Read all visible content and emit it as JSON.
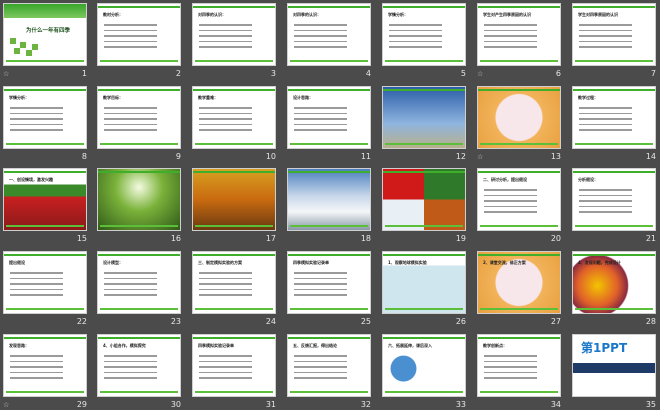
{
  "view": "slide-sorter",
  "accent_color": "#3fae2a",
  "animation_marker_icon": "star-icon",
  "animation_marker_glyph": "☆",
  "slides": [
    {
      "number": "1",
      "title": "为什么一年有四季",
      "kind": "title",
      "animated": true
    },
    {
      "number": "2",
      "title": "教材分析：",
      "kind": "diagram",
      "animated": false
    },
    {
      "number": "3",
      "title": "对四季的认识：",
      "kind": "diagram",
      "animated": false
    },
    {
      "number": "4",
      "title": "对四季的认识：",
      "kind": "diagram",
      "animated": false
    },
    {
      "number": "5",
      "title": "学情分析：",
      "kind": "table",
      "animated": false
    },
    {
      "number": "6",
      "title": "学生对产生四季原因的认识",
      "kind": "text",
      "animated": true
    },
    {
      "number": "7",
      "title": "学生对四季原因的认识",
      "kind": "text",
      "animated": false
    },
    {
      "number": "8",
      "title": "学情分析：",
      "kind": "text",
      "animated": false
    },
    {
      "number": "9",
      "title": "教学目标：",
      "kind": "text",
      "animated": false
    },
    {
      "number": "10",
      "title": "教学重难：",
      "kind": "text",
      "animated": false
    },
    {
      "number": "11",
      "title": "设计思路：",
      "kind": "diagram",
      "animated": false
    },
    {
      "number": "12",
      "title": "",
      "kind": "photo-sky",
      "animated": false
    },
    {
      "number": "13",
      "title": "",
      "kind": "photo-orange",
      "animated": true
    },
    {
      "number": "14",
      "title": "教学过程：",
      "kind": "text",
      "animated": false
    },
    {
      "number": "15",
      "title": "一、创设情境，激发兴趣",
      "kind": "photo-flowers",
      "animated": false
    },
    {
      "number": "16",
      "title": "",
      "kind": "photo-green",
      "animated": false
    },
    {
      "number": "17",
      "title": "",
      "kind": "photo-autumn",
      "animated": false
    },
    {
      "number": "18",
      "title": "",
      "kind": "photo-snow",
      "animated": false
    },
    {
      "number": "19",
      "title": "",
      "kind": "photo-grid",
      "animated": false
    },
    {
      "number": "20",
      "title": "二、研讨分析，提出假设",
      "kind": "text",
      "animated": false
    },
    {
      "number": "21",
      "title": "分析假设：",
      "kind": "diagram",
      "animated": false
    },
    {
      "number": "22",
      "title": "提出假设",
      "kind": "diagram",
      "animated": false
    },
    {
      "number": "23",
      "title": "设计模型：",
      "kind": "diagram",
      "animated": false
    },
    {
      "number": "24",
      "title": "三、制定模拟实验的方案",
      "kind": "text",
      "animated": false
    },
    {
      "number": "25",
      "title": "四季模拟实验记录单",
      "kind": "table",
      "animated": false
    },
    {
      "number": "26",
      "title": "1、观察地球模拟实验",
      "kind": "photo-light",
      "animated": false
    },
    {
      "number": "27",
      "title": "2、课堂交流，修正方案",
      "kind": "photo-orange",
      "animated": false
    },
    {
      "number": "28",
      "title": "4、发现问题，完成设计",
      "kind": "photo-balloon",
      "animated": false
    },
    {
      "number": "29",
      "title": "发现思路：",
      "kind": "diagram",
      "animated": true
    },
    {
      "number": "30",
      "title": "4、小组合作，模拟探究",
      "kind": "text",
      "animated": false
    },
    {
      "number": "31",
      "title": "四季模拟实验记录单",
      "kind": "table",
      "animated": false
    },
    {
      "number": "32",
      "title": "五、反馈汇报，得出结论",
      "kind": "text",
      "animated": false
    },
    {
      "number": "33",
      "title": "六、拓展延伸，课后深入",
      "kind": "photo-globe",
      "animated": false
    },
    {
      "number": "34",
      "title": "教学创新点：",
      "kind": "text",
      "animated": false
    },
    {
      "number": "35",
      "title": "第1PPT",
      "kind": "ad",
      "animated": false
    }
  ]
}
